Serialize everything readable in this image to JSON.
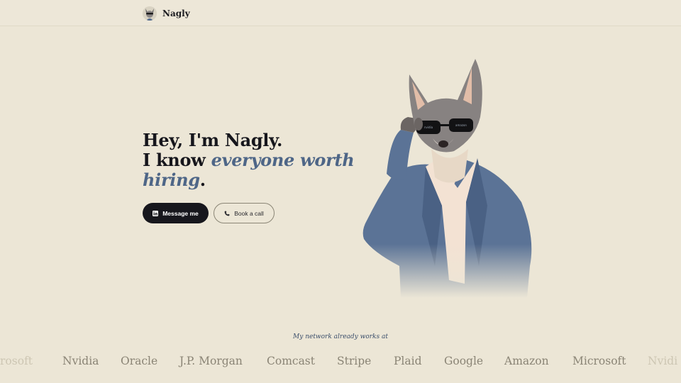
{
  "brand": {
    "name": "Nagly"
  },
  "hero": {
    "line1": "Hey, I'm Nagly.",
    "line2_plain": "I know ",
    "line2_accent": "everyone worth",
    "line3_accent": "hiring",
    "line3_end": "."
  },
  "actions": {
    "message_label": "Message me",
    "book_label": "Book a call"
  },
  "network": {
    "caption": "My network already works at",
    "companies": [
      "rosoft",
      "Nvidia",
      "Oracle",
      "J.P. Morgan",
      "Comcast",
      "Stripe",
      "Plaid",
      "Google",
      "Amazon",
      "Microsoft",
      "Nvidi"
    ]
  },
  "colors": {
    "background": "#ece6d6",
    "accent": "#4e6687",
    "primary_button": "#17171d"
  },
  "icons": {
    "message_button": "linkedin-icon",
    "book_button": "phone-icon"
  }
}
